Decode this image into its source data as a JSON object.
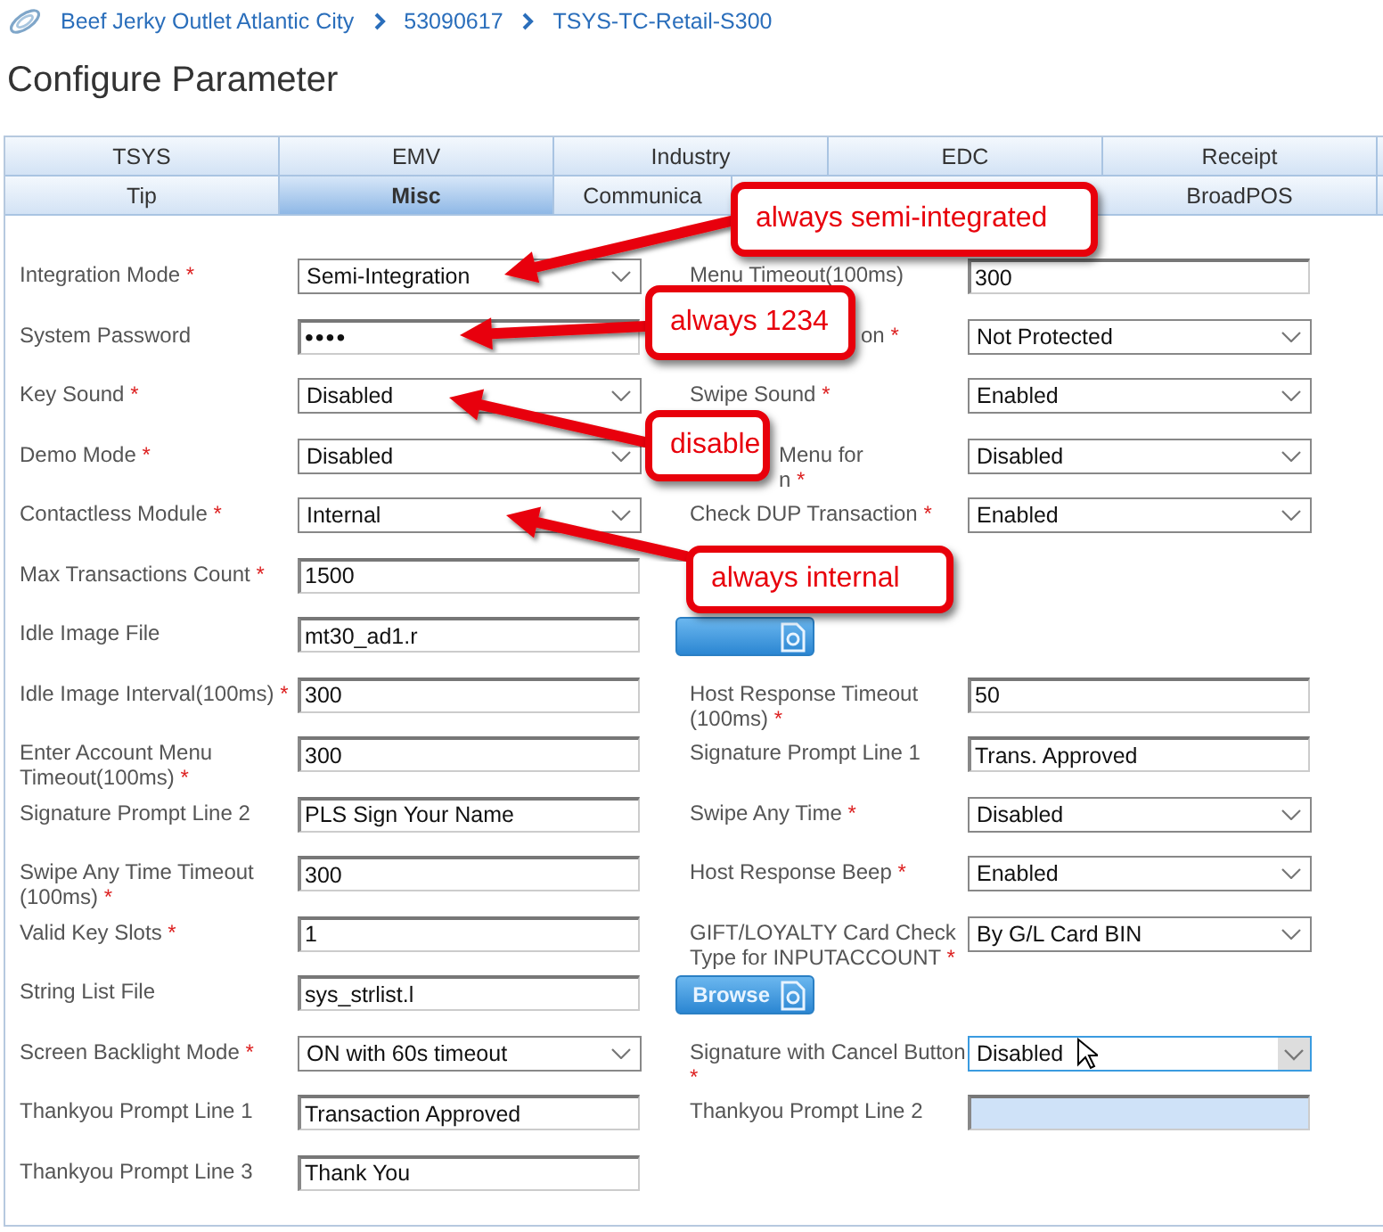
{
  "breadcrumb": [
    "Beef Jerky Outlet Atlantic City",
    "53090617",
    "TSYS-TC-Retail-S300"
  ],
  "title": "Configure Parameter",
  "tab_rows": [
    [
      {
        "label": "TSYS",
        "selected": false
      },
      {
        "label": "EMV",
        "selected": false
      },
      {
        "label": "Industry",
        "selected": false
      },
      {
        "label": "EDC",
        "selected": false
      },
      {
        "label": "Receipt",
        "selected": false
      }
    ],
    [
      {
        "label": "Tip",
        "selected": false
      },
      {
        "label": "Misc",
        "selected": true
      },
      {
        "label": "Communica",
        "selected": false
      },
      {
        "label": "BroadPOS",
        "selected": false
      }
    ]
  ],
  "rows": [
    {
      "left": {
        "kind": "select",
        "label": "Integration Mode",
        "mark": "*",
        "value": "Semi-Integration"
      },
      "right": {
        "kind": "text",
        "label": "Menu Timeout(100ms)",
        "value": "300"
      }
    },
    {
      "left": {
        "kind": "password",
        "label": "System Password",
        "value": "••••"
      },
      "right": {
        "kind": "select",
        "label": "on",
        "mark": "*",
        "value": "Not Protected"
      }
    },
    {
      "left": {
        "kind": "select",
        "label": "Key Sound",
        "mark": "*",
        "value": "Disabled"
      },
      "right": {
        "kind": "select",
        "label": "Swipe Sound",
        "mark": "*",
        "value": "Enabled"
      }
    },
    {
      "left": {
        "kind": "select",
        "label": "Demo Mode",
        "mark": "*",
        "value": "Disabled"
      },
      "right": {
        "kind": "select",
        "label": "Menu for\nn",
        "mark": "*",
        "value": "Disabled"
      }
    },
    {
      "left": {
        "kind": "select",
        "label": "Contactless Module",
        "mark": "*",
        "value": "Internal"
      },
      "right": {
        "kind": "select",
        "label": "Check DUP Transaction",
        "mark": "*",
        "value": "Enabled"
      }
    },
    {
      "left": {
        "kind": "text",
        "label": "Max Transactions Count",
        "mark": "*",
        "value": "1500"
      }
    },
    {
      "left": {
        "kind": "text",
        "label": "Idle Image File",
        "value": "mt30_ad1.r"
      },
      "right": {
        "kind": "browse"
      }
    },
    {
      "left": {
        "kind": "text",
        "label": "Idle Image Interval(100ms)",
        "mark": "*",
        "value": "300"
      },
      "right": {
        "kind": "text",
        "label": "Host Response Timeout (100ms)",
        "mark": "*",
        "value": "50"
      }
    },
    {
      "left": {
        "kind": "text",
        "label": "Enter Account Menu Timeout(100ms)",
        "mark": "*",
        "value": "300"
      },
      "right": {
        "kind": "text",
        "label": "Signature Prompt Line 1",
        "value": "Trans. Approved"
      }
    },
    {
      "left": {
        "kind": "text",
        "label": "Signature Prompt Line 2",
        "value": "PLS Sign Your Name"
      },
      "right": {
        "kind": "select",
        "label": "Swipe Any Time",
        "mark": "*",
        "value": "Disabled"
      }
    },
    {
      "left": {
        "kind": "text",
        "label": "Swipe Any Time Timeout (100ms)",
        "mark": "*",
        "value": "300"
      },
      "right": {
        "kind": "select",
        "label": "Host Response Beep",
        "mark": "*",
        "value": "Enabled"
      }
    },
    {
      "left": {
        "kind": "text",
        "label": "Valid Key Slots",
        "mark": "*",
        "value": "1"
      },
      "right": {
        "kind": "select",
        "label": "GIFT/LOYALTY Card Check Type for INPUTACCOUNT",
        "mark": "*",
        "value": "By G/L Card BIN"
      }
    },
    {
      "left": {
        "kind": "text",
        "label": "String List File",
        "value": "sys_strlist.l"
      },
      "right": {
        "kind": "browse",
        "button": "Browse"
      }
    },
    {
      "left": {
        "kind": "select",
        "label": "Screen Backlight Mode",
        "mark": "*",
        "value": "ON with 60s timeout"
      },
      "right": {
        "kind": "select",
        "label": "Signature with Cancel Button",
        "mark": "*",
        "value": "Disabled",
        "focused": true
      }
    },
    {
      "left": {
        "kind": "text",
        "label": "Thankyou Prompt Line 1",
        "value": "Transaction Approved"
      },
      "right": {
        "kind": "text",
        "label": "Thankyou Prompt Line 2",
        "highlighted": true
      }
    },
    {
      "left": {
        "kind": "text",
        "label": "Thankyou Prompt Line 3",
        "value": "Thank You"
      }
    }
  ],
  "callouts": [
    {
      "text": "always semi-integrated"
    },
    {
      "text": "always 1234"
    },
    {
      "text": "disable"
    },
    {
      "text": "always internal"
    }
  ]
}
